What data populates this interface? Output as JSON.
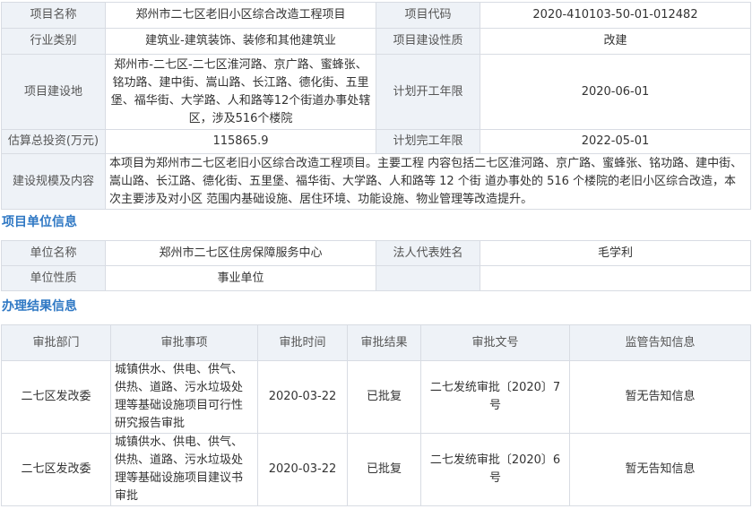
{
  "project": {
    "name_label": "项目名称",
    "name": "郑州市二七区老旧小区综合改造工程项目",
    "code_label": "项目代码",
    "code": "2020-410103-50-01-012482",
    "industry_label": "行业类别",
    "industry": "建筑业-建筑装饰、装修和其他建筑业",
    "nature_label": "项目建设性质",
    "nature": "改建",
    "location_label": "项目建设地",
    "location": "郑州市-二七区-二七区淮河路、京广路、蜜蜂张、铭功路、建中街、嵩山路、长江路、德化街、五里堡、福华街、大学路、人和路等12个街道办事处辖区，涉及516个楼院",
    "start_label": "计划开工年限",
    "start": "2020-06-01",
    "investment_label": "估算总投资(万元)",
    "investment": "115865.9",
    "end_label": "计划完工年限",
    "end": "2022-05-01",
    "scope_label": "建设规模及内容",
    "scope": "本项目为郑州市二七区老旧小区综合改造工程项目。主要工程 内容包括二七区淮河路、京广路、蜜蜂张、铭功路、建中街、嵩山路、长江路、德化街、五里堡、福华街、大学路、人和路等 12 个街 道办事处的 516 个楼院的老旧小区综合改造，本次主要涉及对小区 范围内基础设施、居住环境、功能设施、物业管理等改造提升。"
  },
  "unit_section": {
    "title": "项目单位信息",
    "unit_name_label": "单位名称",
    "unit_name": "郑州市二七区住房保障服务中心",
    "legal_rep_label": "法人代表姓名",
    "legal_rep": "毛学利",
    "unit_type_label": "单位性质",
    "unit_type": "事业单位"
  },
  "result_section": {
    "title": "办理结果信息",
    "columns": [
      "审批部门",
      "审批事项",
      "审批时间",
      "审批结果",
      "审批文号",
      "监管告知信息"
    ],
    "rows": [
      {
        "dept": "二七区发改委",
        "item": "城镇供水、供电、供气、供热、道路、污水垃圾处理等基础设施项目可行性研究报告审批",
        "date": "2020-03-22",
        "result": "已批复",
        "doc_no": "二七发统审批〔2020〕7号",
        "notice": "暂无告知信息"
      },
      {
        "dept": "二七区发改委",
        "item": "城镇供水、供电、供气、供热、道路、污水垃圾处理等基础设施项目建议书审批",
        "date": "2020-03-22",
        "result": "已批复",
        "doc_no": "二七发统审批〔2020〕6号",
        "notice": "暂无告知信息"
      }
    ]
  },
  "colors": {
    "label_bg": "#eef2f7",
    "border": "#d8dce3",
    "section_title": "#2f78c4",
    "text": "#333333"
  }
}
